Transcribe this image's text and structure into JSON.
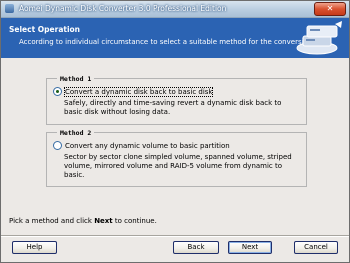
{
  "window": {
    "title": "Aomei Dynamic Disk Converter 3.0 Professional Edition",
    "close_label": "✕"
  },
  "header": {
    "title": "Select Operation",
    "subtitle": "According to individual circumstance to select a suitable method for the conversion."
  },
  "methods": [
    {
      "legend": "Method 1",
      "option_label": "Convert a dynamic disk back to basic disk",
      "description": "Safely, directly and time-saving revert a dynamic disk back to basic disk without losing data.",
      "selected": true
    },
    {
      "legend": "Method 2",
      "option_label": "Convert any dynamic volume to basic partition",
      "description": "Sector by sector clone simpled volume, spanned volume, striped volume, mirrored volume and RAID-5 volume from dynamic to basic.",
      "selected": false
    }
  ],
  "footer": {
    "hint_prefix": "Pick a method and click ",
    "hint_bold": "Next",
    "hint_suffix": " to continue."
  },
  "buttons": {
    "help": "Help",
    "back": "Back",
    "next": "Next",
    "cancel": "Cancel"
  },
  "colors": {
    "header_bg": "#2b63b3",
    "window_bg": "#ece9e6"
  }
}
